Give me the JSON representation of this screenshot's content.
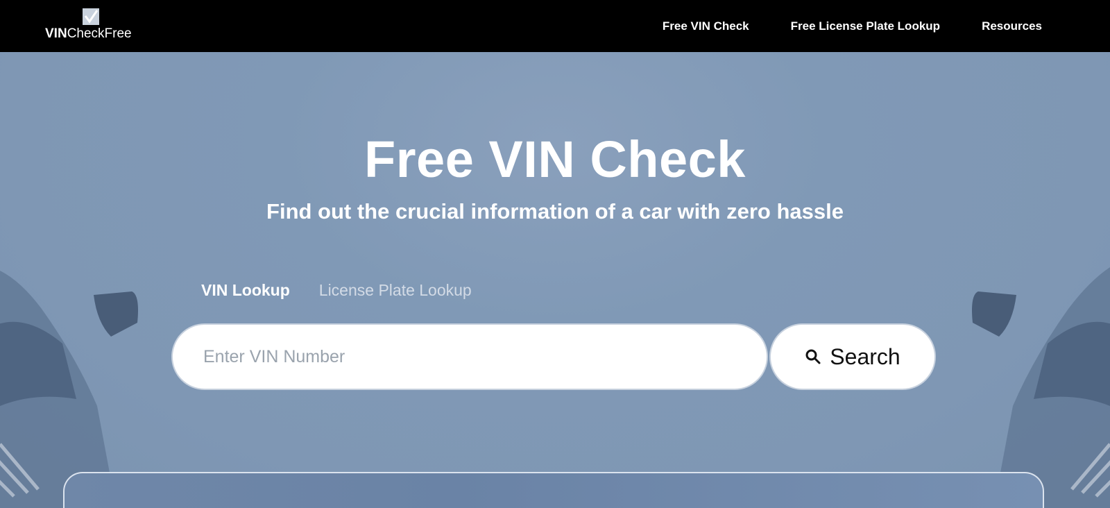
{
  "header": {
    "logo_bold": "VIN",
    "logo_regular": "CheckFree",
    "nav": [
      {
        "label": "Free VIN Check"
      },
      {
        "label": "Free License Plate Lookup"
      },
      {
        "label": "Resources"
      }
    ]
  },
  "hero": {
    "title": "Free VIN Check",
    "subtitle": "Find out the crucial information of a car with zero hassle",
    "tabs": [
      {
        "label": "VIN Lookup",
        "active": true
      },
      {
        "label": "License Plate Lookup",
        "active": false
      }
    ],
    "search": {
      "placeholder": "Enter VIN Number",
      "button_label": "Search",
      "button_icon": "search-icon"
    }
  },
  "colors": {
    "topbar": "#000000",
    "hero_bg": "#8099b6",
    "text_light": "#ffffff"
  }
}
